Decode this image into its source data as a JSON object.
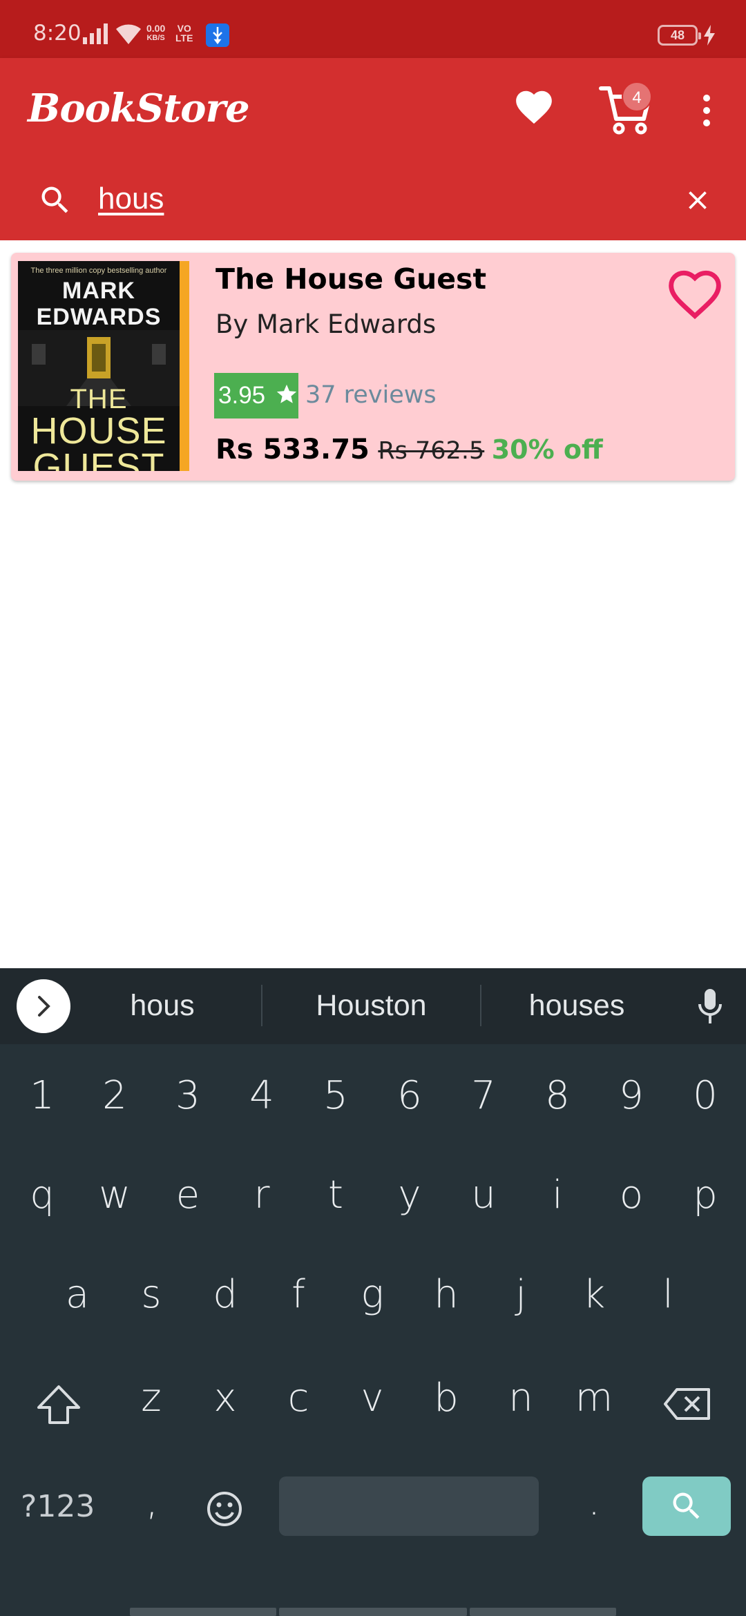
{
  "status_bar": {
    "time": "8:20",
    "net_speed_value": "0.00",
    "net_speed_unit": "KB/S",
    "volte_top": "VO",
    "volte_bottom": "LTE",
    "battery": "48"
  },
  "app_bar": {
    "title": "BookStore",
    "cart_count": "4"
  },
  "search": {
    "query": "hous",
    "placeholder": ""
  },
  "results": [
    {
      "cover": {
        "tagline": "The three million copy bestselling author",
        "author_line1": "MARK",
        "author_line2": "EDWARDS",
        "title_line1": "THE",
        "title_line2": "HOUSE",
        "title_line3": "GUEST"
      },
      "title": "The House Guest",
      "author": "By Mark Edwards",
      "rating": "3.95",
      "reviews": "37 reviews",
      "price": "Rs 533.75",
      "original_price": "Rs 762.5",
      "discount": "30% off"
    }
  ],
  "keyboard": {
    "suggestions": [
      "hous",
      "Houston",
      "houses"
    ],
    "number_row": [
      "1",
      "2",
      "3",
      "4",
      "5",
      "6",
      "7",
      "8",
      "9",
      "0"
    ],
    "row1": [
      "q",
      "w",
      "e",
      "r",
      "t",
      "y",
      "u",
      "i",
      "o",
      "p"
    ],
    "row2": [
      "a",
      "s",
      "d",
      "f",
      "g",
      "h",
      "j",
      "k",
      "l"
    ],
    "row3": [
      "z",
      "x",
      "c",
      "v",
      "b",
      "n",
      "m"
    ],
    "symbols_key": "?123",
    "comma_key": ",",
    "period_key": "."
  },
  "colors": {
    "status_bar": "#b71c1c",
    "app_bar": "#d32f2f",
    "card_background": "#ffcdd2",
    "rating_badge": "#4caf50",
    "discount_text": "#4caf50",
    "favorite_heart": "#e91e63",
    "keyboard_background": "#263238",
    "search_key": "#80cbc4"
  },
  "icons": {
    "wishlist": "heart-icon",
    "cart": "cart-icon",
    "menu": "more-vert-icon",
    "search": "search-icon",
    "clear": "close-icon",
    "favorite": "heart-outline-icon",
    "rating": "star-icon",
    "voice": "mic-icon",
    "shift": "shift-icon",
    "backspace": "backspace-icon",
    "emoji": "emoji-icon",
    "suggestions_expand": "chevron-right-icon"
  }
}
